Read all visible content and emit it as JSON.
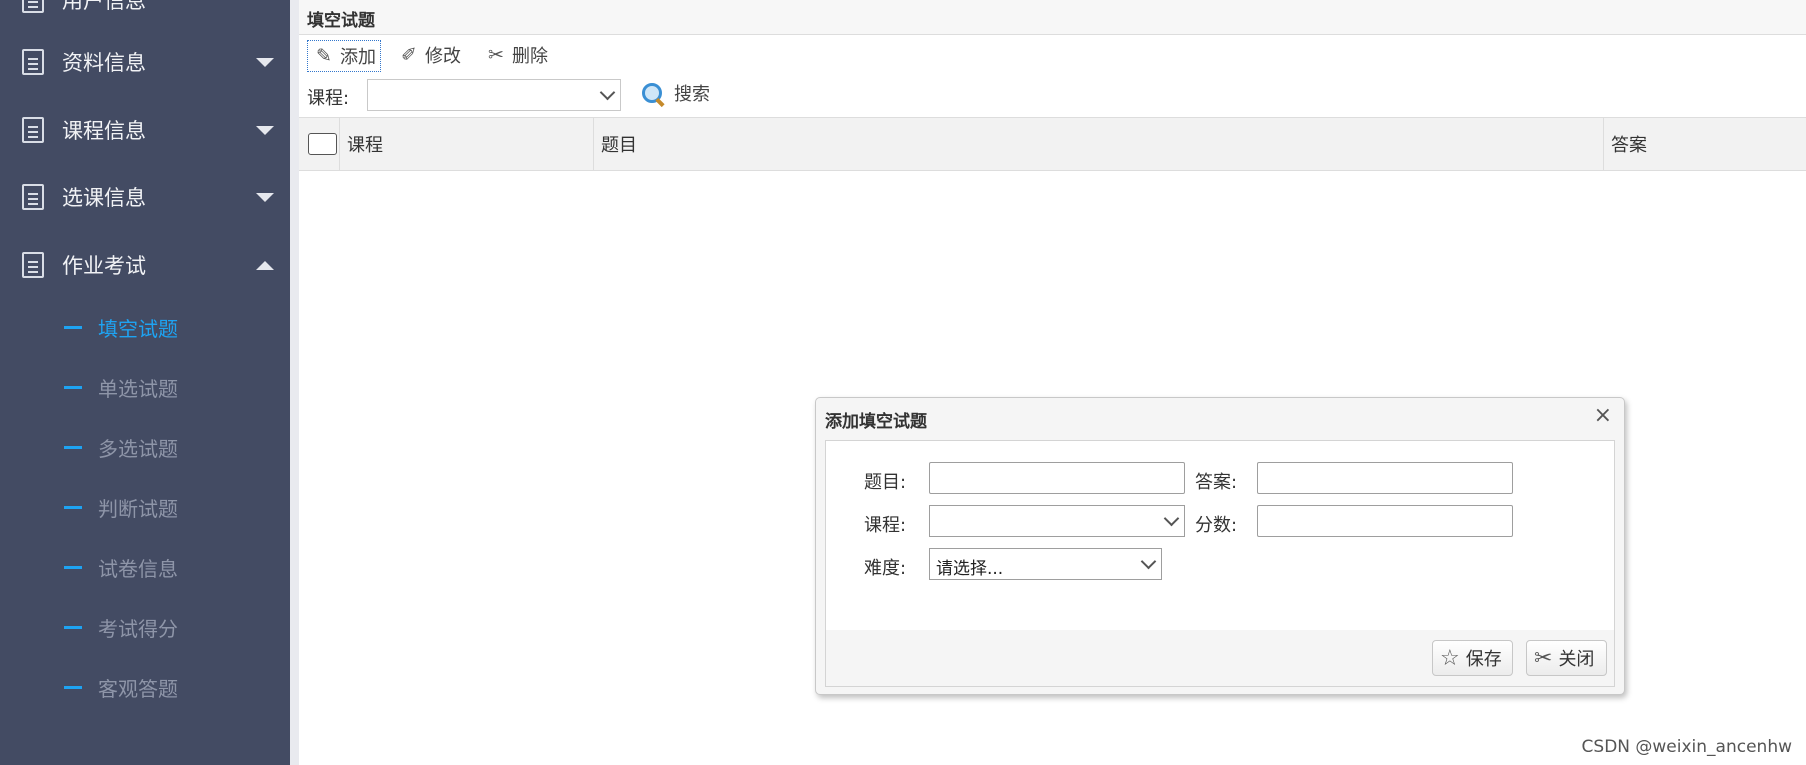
{
  "sidebar": {
    "menu_top_partial": "用户信息",
    "menus": [
      {
        "label": "资料信息",
        "expanded": false
      },
      {
        "label": "课程信息",
        "expanded": false
      },
      {
        "label": "选课信息",
        "expanded": false
      },
      {
        "label": "作业考试",
        "expanded": true
      }
    ],
    "sub_items": [
      {
        "label": "填空试题",
        "active": true
      },
      {
        "label": "单选试题",
        "active": false
      },
      {
        "label": "多选试题",
        "active": false
      },
      {
        "label": "判断试题",
        "active": false
      },
      {
        "label": "试卷信息",
        "active": false
      },
      {
        "label": "考试得分",
        "active": false
      },
      {
        "label": "客观答题",
        "active": false
      }
    ],
    "colors": {
      "bg": "#434b63",
      "accent": "#1ea3f2"
    }
  },
  "panel": {
    "title": "填空试题",
    "toolbar": {
      "add": "添加",
      "edit": "修改",
      "delete": "删除"
    },
    "search": {
      "course_label": "课程:",
      "course_value": "",
      "search_button": "搜索"
    },
    "grid": {
      "columns": [
        "课程",
        "题目",
        "答案"
      ]
    }
  },
  "dialog": {
    "title": "添加填空试题",
    "fields": {
      "question_label": "题目:",
      "answer_label": "答案:",
      "course_label": "课程:",
      "score_label": "分数:",
      "difficulty_label": "难度:",
      "difficulty_value": "请选择..."
    },
    "buttons": {
      "save": "保存",
      "close": "关闭"
    },
    "close_icon": "×"
  },
  "watermark": "CSDN @weixin_ancenhw"
}
